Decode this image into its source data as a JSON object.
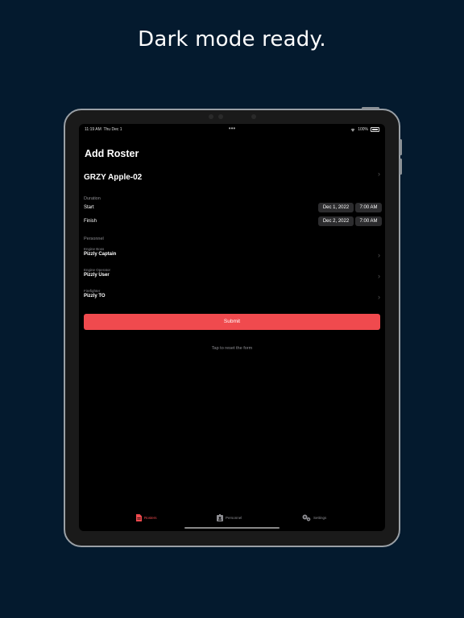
{
  "headline": "Dark mode ready.",
  "status_bar": {
    "time": "11:19 AM",
    "date": "Thu Dec 1",
    "battery": "100%"
  },
  "screen_title": "Add Roster",
  "roster_name": "GRZY Apple-02",
  "duration": {
    "label": "Duration",
    "start": {
      "label": "Start",
      "date": "Dec 1, 2022",
      "time": "7:00 AM"
    },
    "finish": {
      "label": "Finish",
      "date": "Dec 2, 2022",
      "time": "7:00 AM"
    }
  },
  "personnel": {
    "label": "Personnel",
    "members": [
      {
        "role": "Engine Boss",
        "name": "Pizzly Captain"
      },
      {
        "role": "Engine Operator",
        "name": "Pizzly User"
      },
      {
        "role": "Firefighter",
        "name": "Pizzly TO"
      }
    ]
  },
  "submit_label": "Submit",
  "reset_text": "Tap to reset the form",
  "tabs": [
    {
      "label": "Rosters",
      "icon": "document-icon",
      "active": true
    },
    {
      "label": "Personnel",
      "icon": "id-badge-icon",
      "active": false
    },
    {
      "label": "Settings",
      "icon": "gears-icon",
      "active": false
    }
  ],
  "colors": {
    "accent": "#f04a4e",
    "background": "#041a2e",
    "screen": "#000000",
    "pill": "#2c2c2e"
  }
}
